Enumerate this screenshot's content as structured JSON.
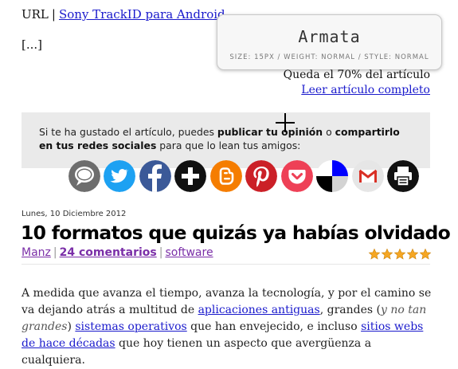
{
  "top": {
    "url_label": "URL",
    "url_sep": "|",
    "url_link": "Sony TrackID para Android",
    "ellipsis": "[...]"
  },
  "font_tooltip": {
    "font_name": "Armata",
    "font_meta": "SIZE: 15PX / WEIGHT: NORMAL / STYLE: NORMAL"
  },
  "article_progress": {
    "remaining_text": "Queda el 70% del artículo",
    "read_full_link": "Leer artículo completo"
  },
  "share": {
    "text_1": "Si te ha gustado el artículo, puedes ",
    "bold_1": "publicar tu opinión",
    "text_2": " o ",
    "bold_2": "compartirlo en tus redes sociales",
    "text_3": " para que lo lean tus amigos:",
    "icons": [
      {
        "name": "comment-icon",
        "color": "#6d6d6d"
      },
      {
        "name": "twitter-icon",
        "color": "#1da1f2"
      },
      {
        "name": "facebook-icon",
        "color": "#3b5998"
      },
      {
        "name": "plus-icon",
        "color": "#111111"
      },
      {
        "name": "blogger-icon",
        "color": "#f57d00"
      },
      {
        "name": "pinterest-icon",
        "color": "#cb2027"
      },
      {
        "name": "pocket-icon",
        "color": "#ee4056"
      },
      {
        "name": "delicious-icon",
        "color": "#0000ff"
      },
      {
        "name": "gmail-icon",
        "color": "#d93025"
      },
      {
        "name": "print-icon",
        "color": "#111111"
      }
    ]
  },
  "post": {
    "date": "Lunes, 10 Diciembre 2012",
    "title": "10 formatos que quizás ya habías olvidado",
    "author": "Manz",
    "comments": "24 comentarios",
    "category": "software",
    "separator": "|",
    "rating_stars": 5,
    "intro": {
      "t1": "A medida que avanza el tiempo, avanza la tecnología, y por el camino se va dejando atrás a multitud de ",
      "l1": "aplicaciones antiguas",
      "t2": ", grandes (",
      "em": "y no tan grandes",
      "t3": ") ",
      "l2": "sistemas operativos",
      "t4": " que han envejecido, e incluso ",
      "l3": "sitios webs de hace décadas",
      "t5": " que hoy tienen un aspecto que avergüenza a cualquiera."
    }
  },
  "colors": {
    "link": "#1a1acc",
    "meta_link": "#7b2fa8",
    "share_bg": "#eaeaea",
    "star": "#f5a623"
  }
}
